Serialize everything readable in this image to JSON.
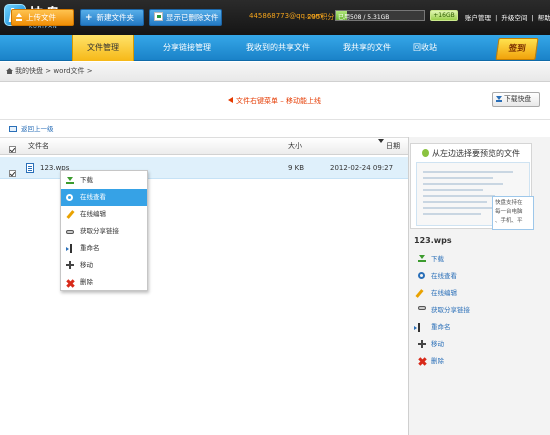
{
  "app": {
    "logo_text": "快盘",
    "logo_sub": "KUAIPAN"
  },
  "account": {
    "email": "445868773@qq.com",
    "points": "295积分",
    "storage_text": "已用508 / 5.31GB",
    "storage_used_fraction": 0.12,
    "gift_label": "+16GB",
    "links": [
      "账户管理",
      "升级空间",
      "帮助"
    ],
    "separator": "|"
  },
  "nav": {
    "tabs": [
      "文件管理",
      "分享链接管理",
      "我收到的共享文件",
      "我共享的文件",
      "回收站"
    ],
    "active": "文件管理",
    "signin_label": "签到"
  },
  "breadcrumb": {
    "items": [
      "我的快盘",
      "word文件"
    ],
    "separator": ">"
  },
  "toolbar": {
    "upload_label": "上传文件",
    "newfolder_label": "新建文件夹",
    "showdeleted_label": "显示已删除文件",
    "hint": "文件右键菜单 – 移动能上线",
    "download_label": "下载快盘"
  },
  "list": {
    "back_label": "返回上一级",
    "columns": {
      "name": "文件名",
      "size": "大小",
      "date": "日期"
    },
    "files": [
      {
        "name": "123.wps",
        "size": "9 KB",
        "date": "2012-02-24 09:27"
      }
    ]
  },
  "context_menu": {
    "items": [
      "下载",
      "在线查看",
      "在线编辑",
      "获取分享链接",
      "重命名",
      "移动",
      "删除"
    ],
    "selected": "在线查看"
  },
  "preview": {
    "title": "从左边选择要预览的文件",
    "bubble_text": [
      "快盘支持在",
      "每一台电脑",
      "、手机、平"
    ],
    "file_name": "123.wps",
    "actions": [
      "下载",
      "在线查看",
      "在线编辑",
      "获取分享链接",
      "重命名",
      "移动",
      "删除"
    ]
  },
  "colors": {
    "nav_blue": "#1f8fd6",
    "active_tab": "#f6c12a",
    "upload_orange": "#f29a10",
    "hint_red": "#e53a00",
    "selection_blue": "#36a2e6"
  }
}
